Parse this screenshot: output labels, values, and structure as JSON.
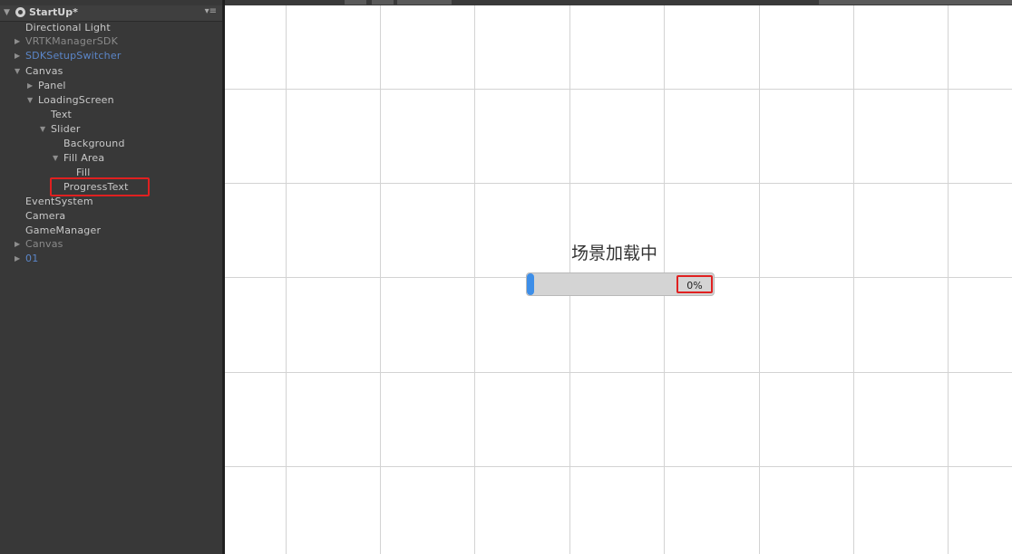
{
  "hierarchy": {
    "scene_name": "StartUp*",
    "menu_icon": "menu-icon",
    "items": [
      {
        "label": "Directional Light"
      },
      {
        "label": "VRTKManagerSDK"
      },
      {
        "label": "SDKSetupSwitcher"
      },
      {
        "label": "Canvas"
      },
      {
        "label": "Panel"
      },
      {
        "label": "LoadingScreen"
      },
      {
        "label": "Text"
      },
      {
        "label": "Slider"
      },
      {
        "label": "Background"
      },
      {
        "label": "Fill Area"
      },
      {
        "label": "Fill"
      },
      {
        "label": "ProgressText"
      },
      {
        "label": "EventSystem"
      },
      {
        "label": "Camera"
      },
      {
        "label": "GameManager"
      },
      {
        "label": "Canvas"
      },
      {
        "label": "01"
      }
    ],
    "highlight_color": "#e02020",
    "prefab_color": "#5b86c9"
  },
  "scene": {
    "loading_title": "场景加载中",
    "progress_text": "0%",
    "progress_value": 0,
    "fill_color": "#3d8ee8"
  }
}
